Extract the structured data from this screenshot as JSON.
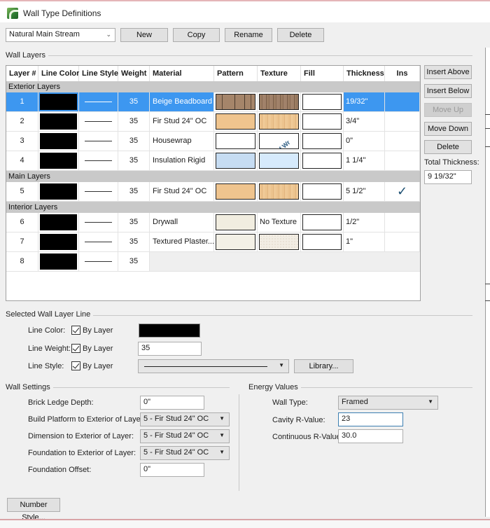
{
  "window": {
    "title": "Wall Type Definitions",
    "icon": "app-logo-icon"
  },
  "toolbar": {
    "wall_type_selected": "Natural Main Stream",
    "new_label": "New",
    "copy_label": "Copy",
    "rename_label": "Rename",
    "delete_label": "Delete"
  },
  "wall_layers": {
    "group_label": "Wall Layers",
    "columns": [
      "Layer #",
      "Line Color",
      "Line Style",
      "Weight",
      "Material",
      "Pattern",
      "Texture",
      "Fill",
      "Thickness",
      "Ins"
    ],
    "sections": {
      "exterior": "Exterior Layers",
      "main": "Main Layers",
      "interior": "Interior Layers"
    },
    "rows": [
      {
        "layer": "1",
        "line_color": "#000000",
        "weight": "35",
        "material": "Beige Beadboard",
        "pattern": "beige-beadboard",
        "texture": "beige-beadboard",
        "texture_text": "",
        "fill": "#ffffff",
        "thickness": "19/32\"",
        "ins": "",
        "selected": true
      },
      {
        "layer": "2",
        "line_color": "#000000",
        "weight": "35",
        "material": "Fir Stud 24\" OC",
        "pattern": "fir-stud",
        "texture": "fir-wood",
        "texture_text": "",
        "fill": "#ffffff",
        "thickness": "3/4\"",
        "ins": ""
      },
      {
        "layer": "3",
        "line_color": "#000000",
        "weight": "35",
        "material": "Housewrap",
        "pattern": "none",
        "texture": "housewrap-watermark",
        "texture_text": "Chief Wr",
        "fill": "#ffffff",
        "thickness": "0\"",
        "ins": ""
      },
      {
        "layer": "4",
        "line_color": "#000000",
        "weight": "35",
        "material": "Insulation  Rigid",
        "pattern": "insulation",
        "texture": "insulation",
        "texture_text": "",
        "fill": "#ffffff",
        "thickness": "1 1/4\"",
        "ins": ""
      },
      {
        "layer": "5",
        "line_color": "#000000",
        "weight": "35",
        "material": "Fir Stud 24\" OC",
        "pattern": "fir-stud",
        "texture": "fir-wood",
        "texture_text": "",
        "fill": "#ffffff",
        "thickness": "5 1/2\"",
        "ins": "checked"
      },
      {
        "layer": "6",
        "line_color": "#000000",
        "weight": "35",
        "material": "Drywall",
        "pattern": "drywall",
        "texture": "none",
        "texture_text": "No Texture",
        "fill": "#ffffff",
        "thickness": "1/2\"",
        "ins": ""
      },
      {
        "layer": "7",
        "line_color": "#000000",
        "weight": "35",
        "material": "Textured Plaster...",
        "pattern": "plaster",
        "texture": "plaster",
        "texture_text": "",
        "fill": "#ffffff",
        "thickness": "1\"",
        "ins": ""
      },
      {
        "layer": "8",
        "line_color": "#000000",
        "weight": "35",
        "material": "",
        "pattern": "",
        "texture": "",
        "texture_text": "",
        "fill": "",
        "thickness": "",
        "ins": ""
      }
    ],
    "buttons": {
      "insert_above": "Insert Above",
      "insert_below": "Insert Below",
      "move_up": "Move Up",
      "move_down": "Move Down",
      "delete": "Delete"
    },
    "total_thickness_label": "Total Thickness:",
    "total_thickness_value": "9 19/32\""
  },
  "selected_line": {
    "group_label": "Selected Wall Layer Line",
    "line_color_label": "Line Color:",
    "line_weight_label": "Line Weight:",
    "line_style_label": "Line Style:",
    "by_layer_label": "By Layer",
    "line_color_value": "#000000",
    "line_weight_value": "35",
    "library_label": "Library..."
  },
  "wall_settings": {
    "group_label": "Wall Settings",
    "brick_ledge_label": "Brick Ledge Depth:",
    "brick_ledge_value": "0\"",
    "build_platform_label": "Build Platform to Exterior of Layer:",
    "build_platform_value": "5 - Fir Stud 24\" OC",
    "dimension_label": "Dimension to Exterior of Layer:",
    "dimension_value": "5 - Fir Stud 24\" OC",
    "foundation_label": "Foundation to Exterior of Layer:",
    "foundation_value": "5 - Fir Stud 24\" OC",
    "foundation_offset_label": "Foundation Offset:",
    "foundation_offset_value": "0\""
  },
  "energy_values": {
    "group_label": "Energy Values",
    "wall_type_label": "Wall Type:",
    "wall_type_value": "Framed",
    "cavity_label": "Cavity R-Value:",
    "cavity_value": "23",
    "continuous_label": "Continuous R-Value:",
    "continuous_value": "30.0"
  },
  "footer": {
    "number_style_label": "Number Style..."
  },
  "colors": {
    "selection": "#3d97f0",
    "section_header": "#c9c9c9",
    "checkmark": "#1c4f72"
  }
}
